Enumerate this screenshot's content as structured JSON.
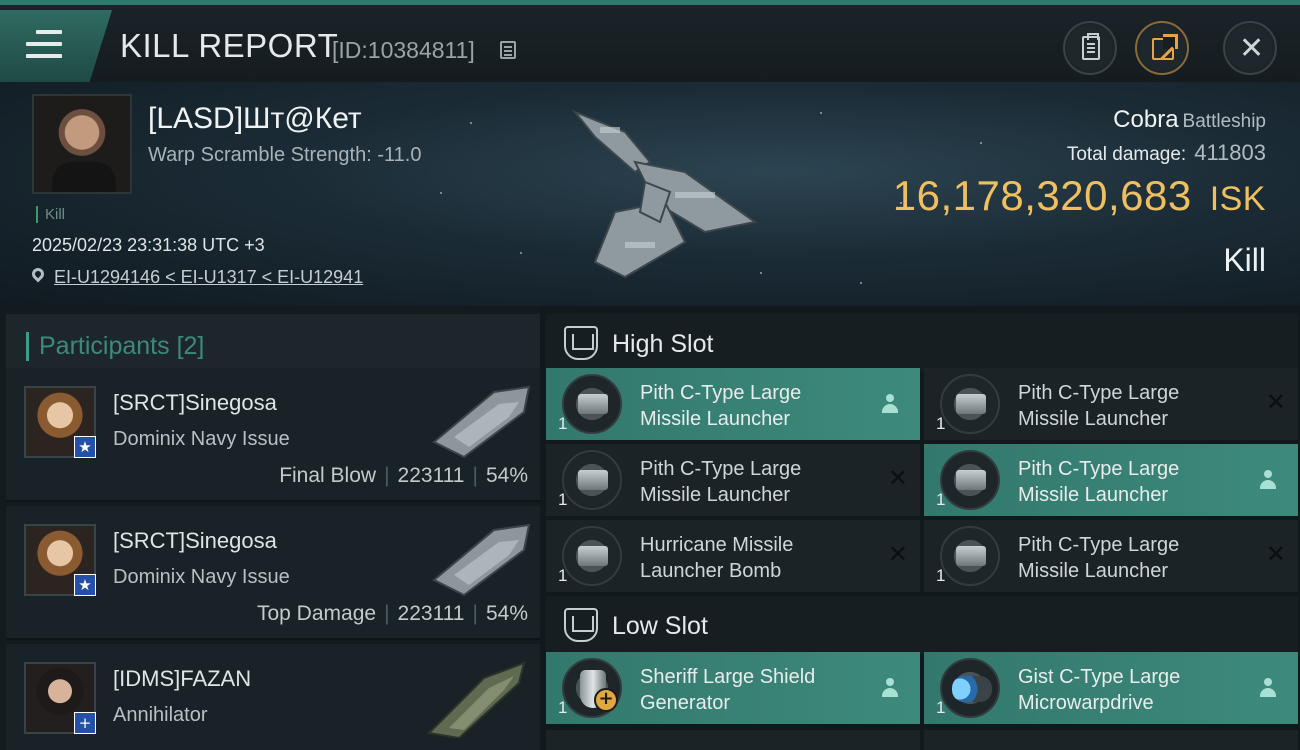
{
  "header": {
    "title": "KILL REPORT",
    "report_id": "[ID:10384811]"
  },
  "victim": {
    "name": "[LASD]Шт@Кет",
    "warp_scramble": "Warp Scramble Strength: -11.0",
    "kill_tag": "Kill",
    "timestamp": "2025/02/23 23:31:38 UTC +3",
    "location": "EI-U1294146 < EI-U1317 < EI-U12941",
    "ship": "Cobra",
    "ship_class": "Battleship",
    "total_damage_label": "Total damage:",
    "total_damage": "411803",
    "isk_value": "16,178,320,683",
    "isk_unit": "ISK",
    "result": "Kill"
  },
  "participants": {
    "label": "Participants",
    "count": "[2]",
    "items": [
      {
        "name": "[SRCT]Sinegosa",
        "ship": "Dominix Navy Issue",
        "role": "Final Blow",
        "damage": "223111",
        "percent": "54%",
        "badge": "★"
      },
      {
        "name": "[SRCT]Sinegosa",
        "ship": "Dominix Navy Issue",
        "role": "Top Damage",
        "damage": "223111",
        "percent": "54%",
        "badge": "★"
      },
      {
        "name": "[IDMS]FAZAN",
        "ship": "Annihilator",
        "badge": "+"
      }
    ]
  },
  "fitting": {
    "high_slot_label": "High Slot",
    "low_slot_label": "Low Slot",
    "high": [
      {
        "name_line1": "Pith C-Type Large",
        "name_line2": "Missile Launcher",
        "qty": "1",
        "status": "dropped"
      },
      {
        "name_line1": "Pith C-Type Large",
        "name_line2": "Missile Launcher",
        "qty": "1",
        "status": "destroyed"
      },
      {
        "name_line1": "Pith C-Type Large",
        "name_line2": "Missile Launcher",
        "qty": "1",
        "status": "destroyed"
      },
      {
        "name_line1": "Pith C-Type Large",
        "name_line2": "Missile Launcher",
        "qty": "1",
        "status": "dropped"
      },
      {
        "name_line1": "Hurricane Missile",
        "name_line2": "Launcher Bomb",
        "qty": "1",
        "status": "destroyed"
      },
      {
        "name_line1": "Pith C-Type Large",
        "name_line2": "Missile Launcher",
        "qty": "1",
        "status": "destroyed"
      }
    ],
    "low": [
      {
        "name_line1": "Sheriff Large Shield",
        "name_line2": "Generator",
        "qty": "1",
        "status": "dropped"
      },
      {
        "name_line1": "Gist C-Type Large",
        "name_line2": "Microwarpdrive",
        "qty": "1",
        "status": "dropped"
      }
    ]
  },
  "colors": {
    "accent": "#3d8a7c",
    "isk": "#f0c060",
    "owned_row": "#3d8a7c"
  },
  "icons": [
    "menu-icon",
    "copy-icon",
    "clipboard-icon",
    "share-icon",
    "close-icon",
    "location-pin-icon",
    "slot-icon",
    "person-icon",
    "x-icon"
  ]
}
